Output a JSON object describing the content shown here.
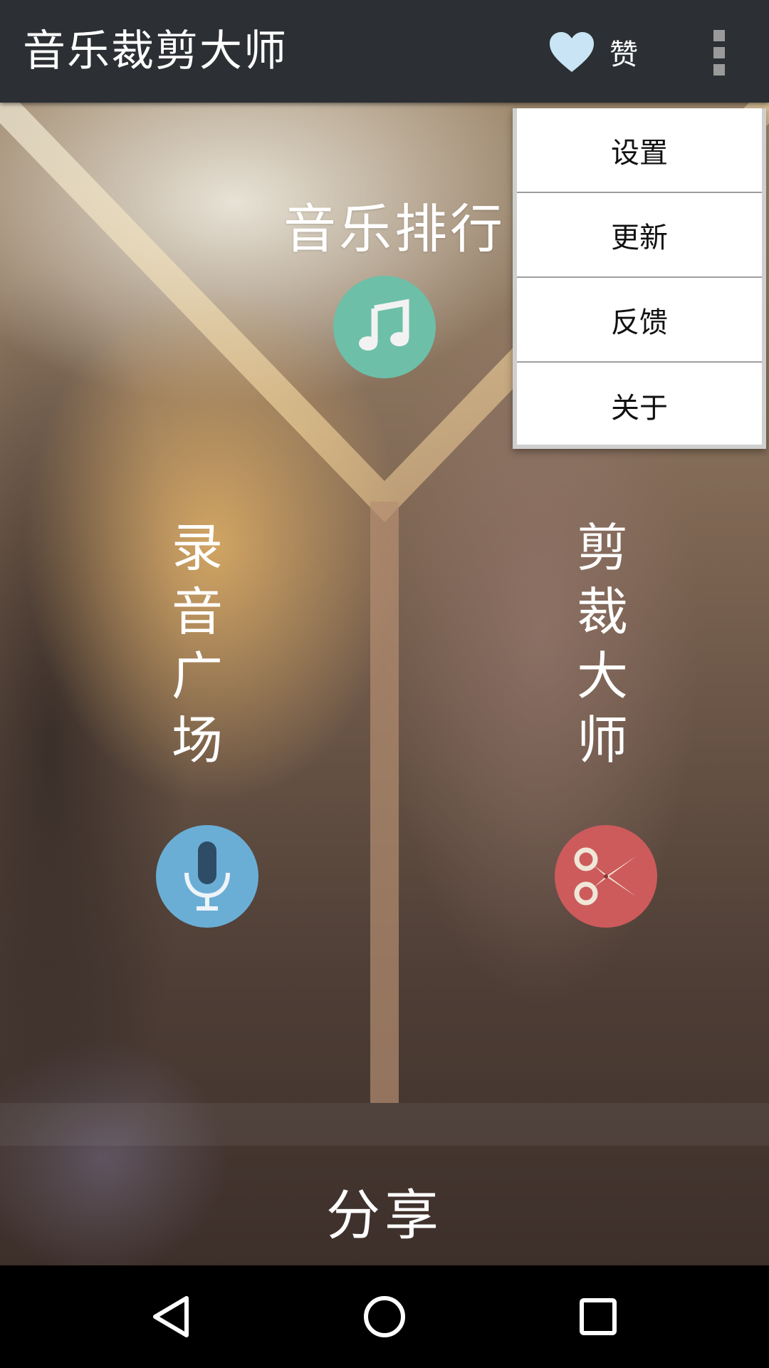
{
  "appbar": {
    "title": "音乐裁剪大师",
    "like_label": "赞",
    "like_icon": "heart-icon",
    "overflow_icon": "more-vert-icon"
  },
  "features": {
    "ranking": {
      "label": "音乐排行",
      "icon": "music-note-icon",
      "color": "#6dbfa8"
    },
    "recording": {
      "label": "录音广场",
      "icon": "microphone-icon",
      "color": "#6aaed6"
    },
    "cutter": {
      "label": "剪裁大师",
      "icon": "scissors-icon",
      "color": "#cd5b5b"
    }
  },
  "share": {
    "label": "分享"
  },
  "menu": {
    "items": [
      {
        "label": "设置"
      },
      {
        "label": "更新"
      },
      {
        "label": "反馈"
      },
      {
        "label": "关于"
      }
    ]
  },
  "navbar": {
    "back_icon": "back-triangle-icon",
    "home_icon": "home-circle-icon",
    "recents_icon": "recents-square-icon"
  }
}
